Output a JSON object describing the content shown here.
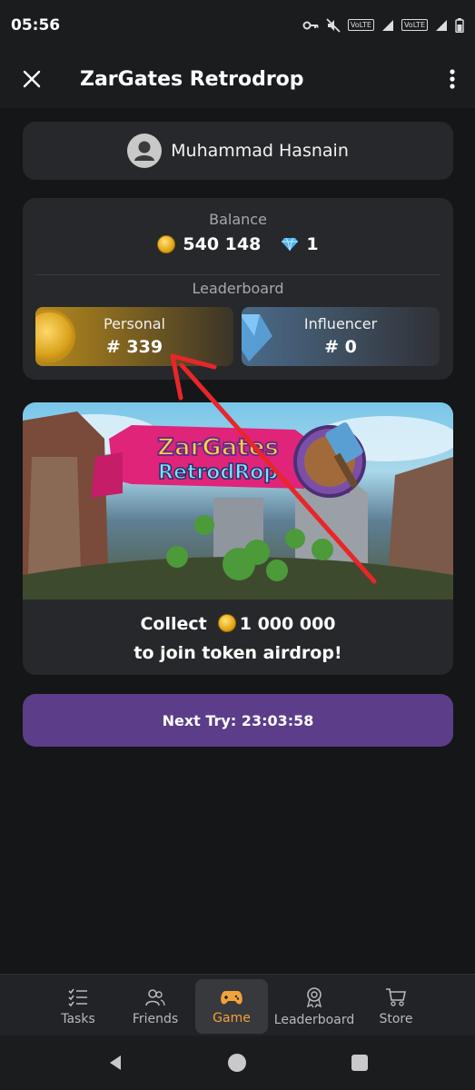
{
  "status_bar": {
    "time": "05:56",
    "volte1": "VoLTE",
    "volte2": "VoLTE",
    "icons": [
      "key-icon",
      "mute-icon",
      "signal-icon",
      "signal-icon",
      "battery-icon"
    ]
  },
  "app_bar": {
    "title": "ZarGates Retrodrop"
  },
  "user": {
    "name": "Muhammad Hasnain"
  },
  "balance": {
    "label": "Balance",
    "coins": "540 148",
    "gems": "1"
  },
  "leaderboard": {
    "label": "Leaderboard",
    "personal_title": "Personal",
    "personal_value": "# 339",
    "influencer_title": "Influencer",
    "influencer_value": "# 0"
  },
  "promo": {
    "banner_line1": "ZarGates",
    "banner_line2": "RetrodRop",
    "collect_prefix": "Collect",
    "collect_amount": "1 000 000",
    "line2": "to join token airdrop!"
  },
  "next_try": {
    "label": "Next Try: 23:03:58"
  },
  "bottom_nav": {
    "items": [
      {
        "label": "Tasks",
        "icon": "tasks-icon"
      },
      {
        "label": "Friends",
        "icon": "friends-icon"
      },
      {
        "label": "Game",
        "icon": "gamepad-icon"
      },
      {
        "label": "Leaderboard",
        "icon": "award-icon"
      },
      {
        "label": "Store",
        "icon": "cart-icon"
      }
    ],
    "active_index": 2
  },
  "colors": {
    "background": "#151618",
    "card": "#27282b",
    "accent": "#f2a23a",
    "button": "#5b3d8a",
    "annotation_arrow": "#e8262a"
  }
}
